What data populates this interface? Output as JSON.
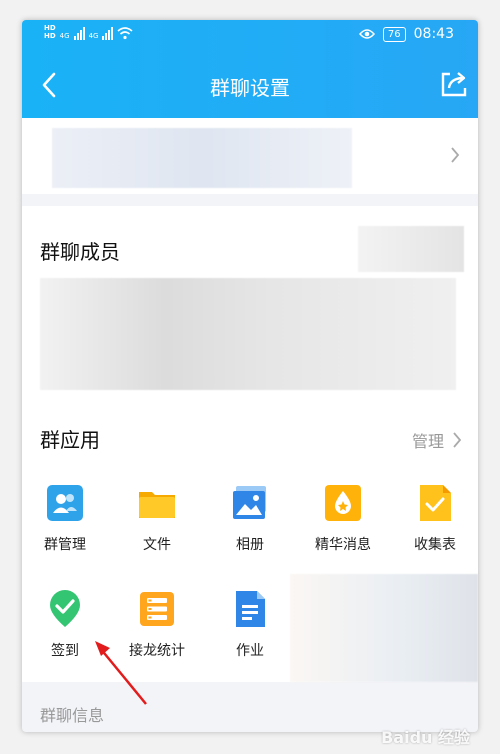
{
  "status": {
    "net1": "HD 4G",
    "net2": "HD 4G",
    "battery": "76",
    "time": "08:43"
  },
  "nav": {
    "title": "群聊设置"
  },
  "members": {
    "title": "群聊成员"
  },
  "apps_section": {
    "title": "群应用",
    "manage_label": "管理",
    "apps": [
      {
        "label": "群管理",
        "icon": "group-manage-icon",
        "color": "#2fa3ea"
      },
      {
        "label": "文件",
        "icon": "folder-icon",
        "color": "#ffbf14"
      },
      {
        "label": "相册",
        "icon": "photo-album-icon",
        "color": "#2f86e6"
      },
      {
        "label": "精华消息",
        "icon": "essence-message-icon",
        "color": "#ffb20a"
      },
      {
        "label": "收集表",
        "icon": "collection-form-icon",
        "color": "#ffc21c"
      },
      {
        "label": "签到",
        "icon": "check-in-icon",
        "color": "#34c573"
      },
      {
        "label": "接龙统计",
        "icon": "relay-statistics-icon",
        "color": "#ffa51e"
      },
      {
        "label": "作业",
        "icon": "homework-icon",
        "color": "#2f86e6"
      }
    ]
  },
  "info": {
    "label": "群聊信息"
  },
  "watermark": "Baidu 经验"
}
